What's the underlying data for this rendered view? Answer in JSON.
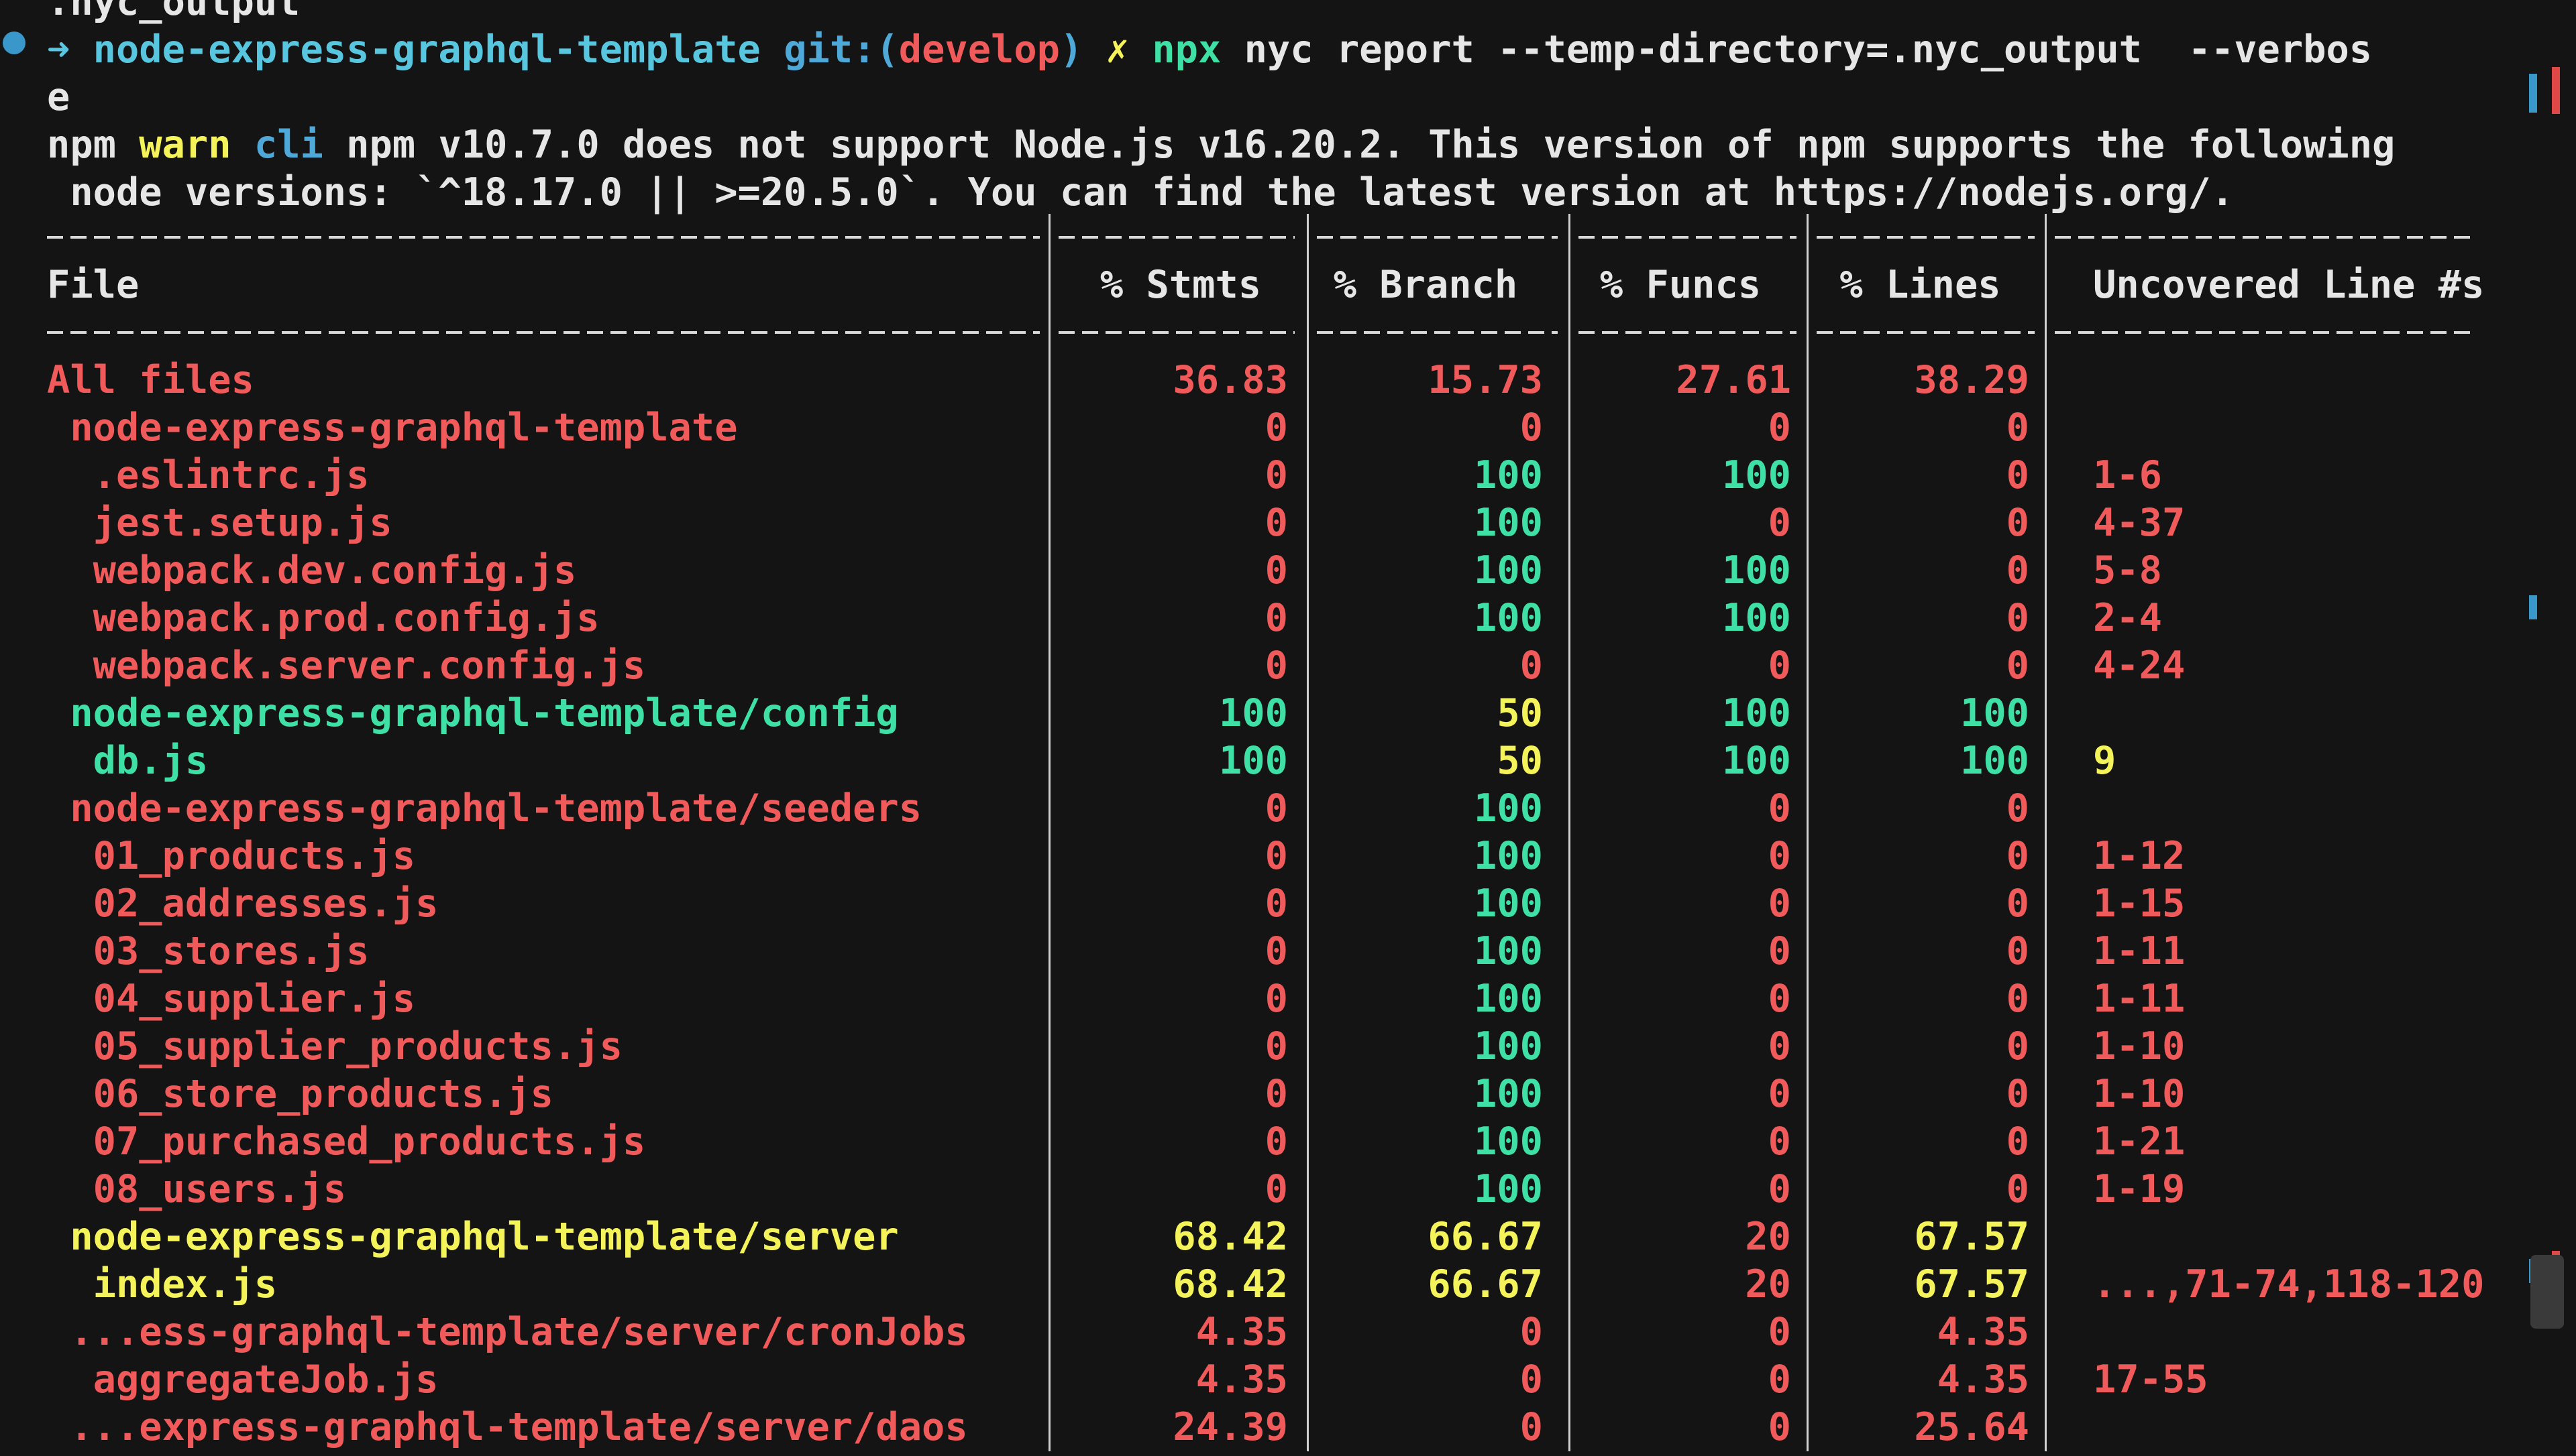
{
  "terminal": {
    "top_fragment": ".nyc_output",
    "prompt": {
      "arrow": "➜",
      "directory": "node-express-graphql-template",
      "git_prefix": "git:(",
      "branch": "develop",
      "git_suffix": ")",
      "dirty_mark": "✗",
      "command_npx": "npx",
      "command_rest": "nyc report --temp-directory=.nyc_output  --verbos",
      "command_wrap": "e"
    },
    "warning": {
      "npm": "npm",
      "warn": "warn",
      "cli": "cli",
      "text_line1": "npm v10.7.0 does not support Node.js v16.20.2. This version of npm supports the following",
      "text_line2": " node versions: `^18.17.0 || >=20.5.0`. You can find the latest version at https://nodejs.org/."
    },
    "table": {
      "headers": {
        "file": "File",
        "stmts": "% Stmts",
        "branch": "% Branch",
        "funcs": "% Funcs",
        "lines": "% Lines",
        "uncovered": "Uncovered Line #s"
      },
      "rows": [
        {
          "file": "All files",
          "stmts": "36.83",
          "branch": "15.73",
          "funcs": "27.61",
          "lines": "38.29",
          "uncovered": "",
          "colors": [
            "red",
            "red",
            "red",
            "red",
            "red",
            "red"
          ]
        },
        {
          "file": " node-express-graphql-template",
          "stmts": "0",
          "branch": "0",
          "funcs": "0",
          "lines": "0",
          "uncovered": "",
          "colors": [
            "red",
            "red",
            "red",
            "red",
            "red",
            "red"
          ]
        },
        {
          "file": "  .eslintrc.js",
          "stmts": "0",
          "branch": "100",
          "funcs": "100",
          "lines": "0",
          "uncovered": "1-6",
          "colors": [
            "red",
            "red",
            "green",
            "green",
            "red",
            "red"
          ]
        },
        {
          "file": "  jest.setup.js",
          "stmts": "0",
          "branch": "100",
          "funcs": "0",
          "lines": "0",
          "uncovered": "4-37",
          "colors": [
            "red",
            "red",
            "green",
            "red",
            "red",
            "red"
          ]
        },
        {
          "file": "  webpack.dev.config.js",
          "stmts": "0",
          "branch": "100",
          "funcs": "100",
          "lines": "0",
          "uncovered": "5-8",
          "colors": [
            "red",
            "red",
            "green",
            "green",
            "red",
            "red"
          ]
        },
        {
          "file": "  webpack.prod.config.js",
          "stmts": "0",
          "branch": "100",
          "funcs": "100",
          "lines": "0",
          "uncovered": "2-4",
          "colors": [
            "red",
            "red",
            "green",
            "green",
            "red",
            "red"
          ]
        },
        {
          "file": "  webpack.server.config.js",
          "stmts": "0",
          "branch": "0",
          "funcs": "0",
          "lines": "0",
          "uncovered": "4-24",
          "colors": [
            "red",
            "red",
            "red",
            "red",
            "red",
            "red"
          ]
        },
        {
          "file": " node-express-graphql-template/config",
          "stmts": "100",
          "branch": "50",
          "funcs": "100",
          "lines": "100",
          "uncovered": "",
          "colors": [
            "green",
            "green",
            "yellow",
            "green",
            "green",
            "green"
          ]
        },
        {
          "file": "  db.js",
          "stmts": "100",
          "branch": "50",
          "funcs": "100",
          "lines": "100",
          "uncovered": "9",
          "colors": [
            "green",
            "green",
            "yellow",
            "green",
            "green",
            "yellow"
          ]
        },
        {
          "file": " node-express-graphql-template/seeders",
          "stmts": "0",
          "branch": "100",
          "funcs": "0",
          "lines": "0",
          "uncovered": "",
          "colors": [
            "red",
            "red",
            "green",
            "red",
            "red",
            "red"
          ]
        },
        {
          "file": "  01_products.js",
          "stmts": "0",
          "branch": "100",
          "funcs": "0",
          "lines": "0",
          "uncovered": "1-12",
          "colors": [
            "red",
            "red",
            "green",
            "red",
            "red",
            "red"
          ]
        },
        {
          "file": "  02_addresses.js",
          "stmts": "0",
          "branch": "100",
          "funcs": "0",
          "lines": "0",
          "uncovered": "1-15",
          "colors": [
            "red",
            "red",
            "green",
            "red",
            "red",
            "red"
          ]
        },
        {
          "file": "  03_stores.js",
          "stmts": "0",
          "branch": "100",
          "funcs": "0",
          "lines": "0",
          "uncovered": "1-11",
          "colors": [
            "red",
            "red",
            "green",
            "red",
            "red",
            "red"
          ]
        },
        {
          "file": "  04_supplier.js",
          "stmts": "0",
          "branch": "100",
          "funcs": "0",
          "lines": "0",
          "uncovered": "1-11",
          "colors": [
            "red",
            "red",
            "green",
            "red",
            "red",
            "red"
          ]
        },
        {
          "file": "  05_supplier_products.js",
          "stmts": "0",
          "branch": "100",
          "funcs": "0",
          "lines": "0",
          "uncovered": "1-10",
          "colors": [
            "red",
            "red",
            "green",
            "red",
            "red",
            "red"
          ]
        },
        {
          "file": "  06_store_products.js",
          "stmts": "0",
          "branch": "100",
          "funcs": "0",
          "lines": "0",
          "uncovered": "1-10",
          "colors": [
            "red",
            "red",
            "green",
            "red",
            "red",
            "red"
          ]
        },
        {
          "file": "  07_purchased_products.js",
          "stmts": "0",
          "branch": "100",
          "funcs": "0",
          "lines": "0",
          "uncovered": "1-21",
          "colors": [
            "red",
            "red",
            "green",
            "red",
            "red",
            "red"
          ]
        },
        {
          "file": "  08_users.js",
          "stmts": "0",
          "branch": "100",
          "funcs": "0",
          "lines": "0",
          "uncovered": "1-19",
          "colors": [
            "red",
            "red",
            "green",
            "red",
            "red",
            "red"
          ]
        },
        {
          "file": " node-express-graphql-template/server",
          "stmts": "68.42",
          "branch": "66.67",
          "funcs": "20",
          "lines": "67.57",
          "uncovered": "",
          "colors": [
            "yellow",
            "yellow",
            "yellow",
            "red",
            "yellow",
            "red"
          ]
        },
        {
          "file": "  index.js",
          "stmts": "68.42",
          "branch": "66.67",
          "funcs": "20",
          "lines": "67.57",
          "uncovered": "...,71-74,118-120",
          "colors": [
            "yellow",
            "yellow",
            "yellow",
            "red",
            "yellow",
            "red"
          ]
        },
        {
          "file": " ...ess-graphql-template/server/cronJobs",
          "stmts": "4.35",
          "branch": "0",
          "funcs": "0",
          "lines": "4.35",
          "uncovered": "",
          "colors": [
            "red",
            "red",
            "red",
            "red",
            "red",
            "red"
          ]
        },
        {
          "file": "  aggregateJob.js",
          "stmts": "4.35",
          "branch": "0",
          "funcs": "0",
          "lines": "4.35",
          "uncovered": "17-55",
          "colors": [
            "red",
            "red",
            "red",
            "red",
            "red",
            "red"
          ]
        },
        {
          "file": " ...express-graphql-template/server/daos",
          "stmts": "24.39",
          "branch": "0",
          "funcs": "0",
          "lines": "25.64",
          "uncovered": "",
          "colors": [
            "red",
            "red",
            "red",
            "red",
            "red",
            "red"
          ]
        }
      ]
    },
    "colors": {
      "background": "#141414",
      "red": "#f05a5a",
      "green": "#3ee0a5",
      "yellow": "#f5f35a",
      "cyan": "#59c6e0",
      "accent_blue": "#3a97c9"
    }
  }
}
